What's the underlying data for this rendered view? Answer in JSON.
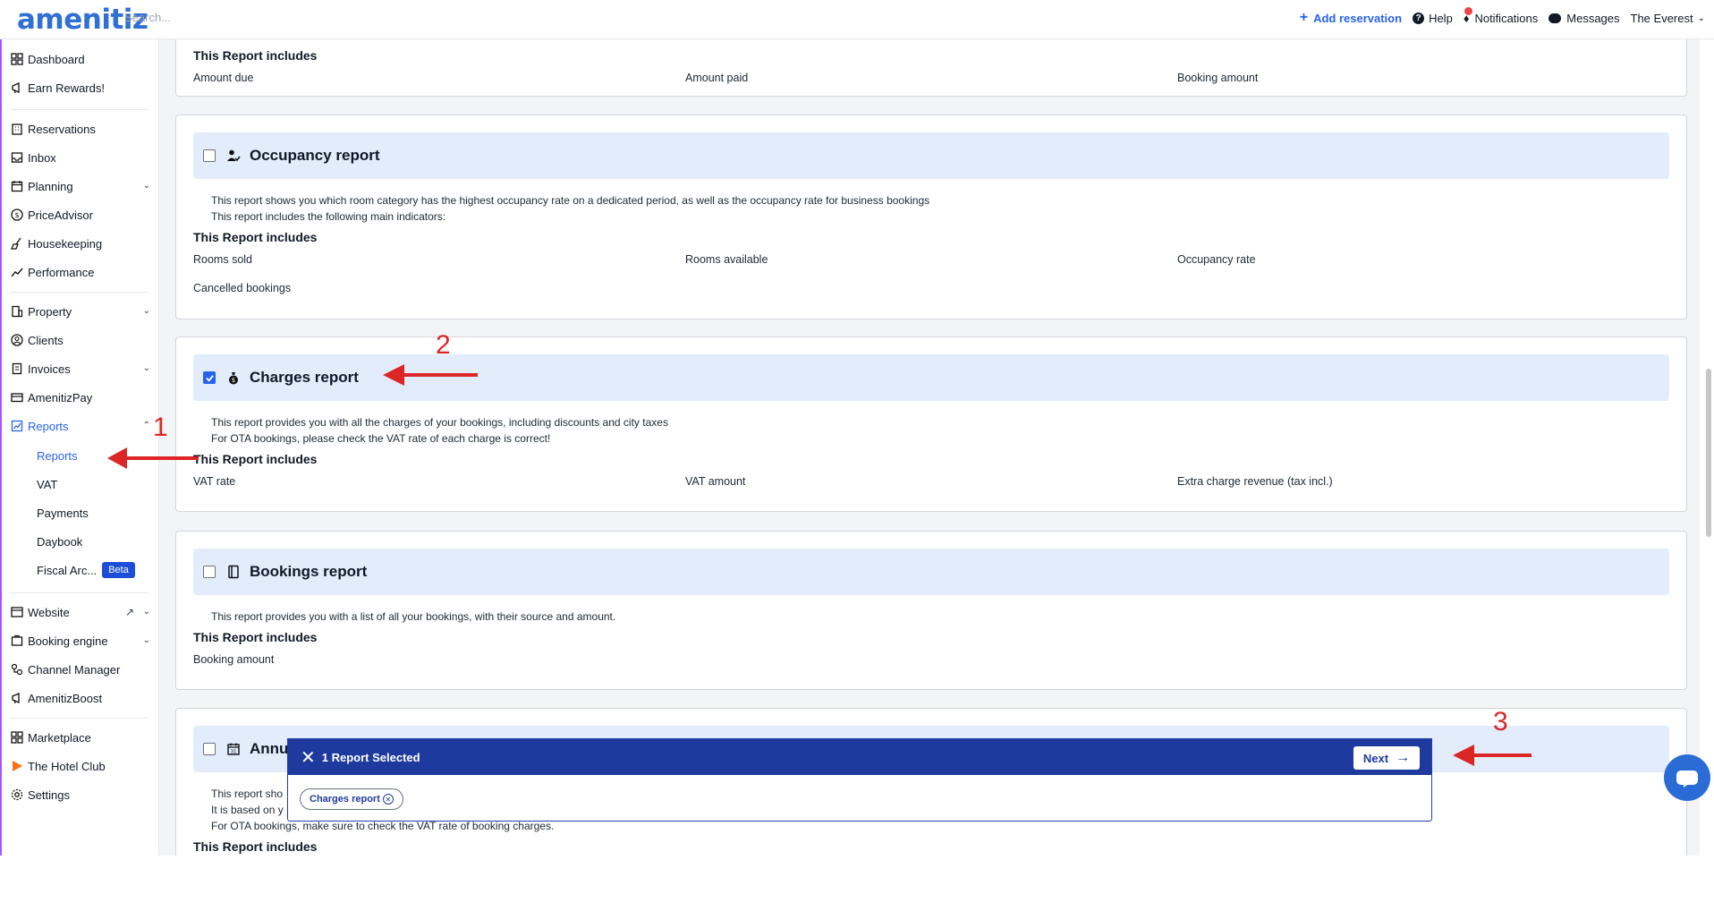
{
  "topbar": {
    "logo": "amenitiz",
    "search_placeholder": "Search...",
    "add_reservation": "Add reservation",
    "help": "Help",
    "notifications": "Notifications",
    "messages": "Messages",
    "property_name": "The Everest"
  },
  "sidebar": {
    "dashboard": "Dashboard",
    "earn_rewards": "Earn Rewards!",
    "reservations": "Reservations",
    "inbox": "Inbox",
    "planning": "Planning",
    "priceadvisor": "PriceAdvisor",
    "housekeeping": "Housekeeping",
    "performance": "Performance",
    "property": "Property",
    "clients": "Clients",
    "invoices": "Invoices",
    "amenitizpay": "AmenitizPay",
    "reports": "Reports",
    "reports_sub": {
      "reports": "Reports",
      "vat": "VAT",
      "payments": "Payments",
      "daybook": "Daybook",
      "fiscal": "Fiscal Arc...",
      "beta": "Beta"
    },
    "website": "Website",
    "booking_engine": "Booking engine",
    "channel_manager": "Channel Manager",
    "amenitizboost": "AmenitizBoost",
    "marketplace": "Marketplace",
    "hotel_club": "The Hotel Club",
    "settings": "Settings"
  },
  "includes_label": "This Report includes",
  "cards": {
    "top": {
      "indicators": [
        "Amount due",
        "Amount paid",
        "Booking amount"
      ]
    },
    "occupancy": {
      "title": "Occupancy report",
      "checked": false,
      "desc_1": "This report shows you which room category has the highest occupancy rate on a dedicated period, as well as the occupancy rate for business bookings",
      "desc_2": "This report includes the following main indicators:",
      "indicators": [
        "Rooms sold",
        "Rooms available",
        "Occupancy rate",
        "Cancelled bookings"
      ]
    },
    "charges": {
      "title": "Charges report",
      "checked": true,
      "desc_1": "This report provides you with all the charges of your bookings, including discounts and city taxes",
      "desc_2": "For OTA bookings, please check the VAT rate of each charge is correct!",
      "indicators": [
        "VAT rate",
        "VAT amount",
        "Extra charge revenue (tax incl.)"
      ]
    },
    "bookings": {
      "title": "Bookings report",
      "checked": false,
      "desc_1": "This report provides you with a list of all your bookings, with their source and amount.",
      "indicators": [
        "Booking amount"
      ]
    },
    "annual": {
      "title": "Annu",
      "checked": false,
      "desc_1": "This report sho",
      "desc_2": "It is based on y",
      "desc_3": "For OTA bookings, make sure to check the VAT rate of booking charges."
    }
  },
  "selection_bar": {
    "title": "1 Report Selected",
    "next": "Next",
    "chip": "Charges report"
  },
  "annotations": [
    "1",
    "2",
    "3"
  ],
  "colors": {
    "accent": "#2563eb",
    "selection_bar": "#1e3a9e",
    "card_header": "#e2ecfb",
    "annotation": "#dc2626"
  }
}
